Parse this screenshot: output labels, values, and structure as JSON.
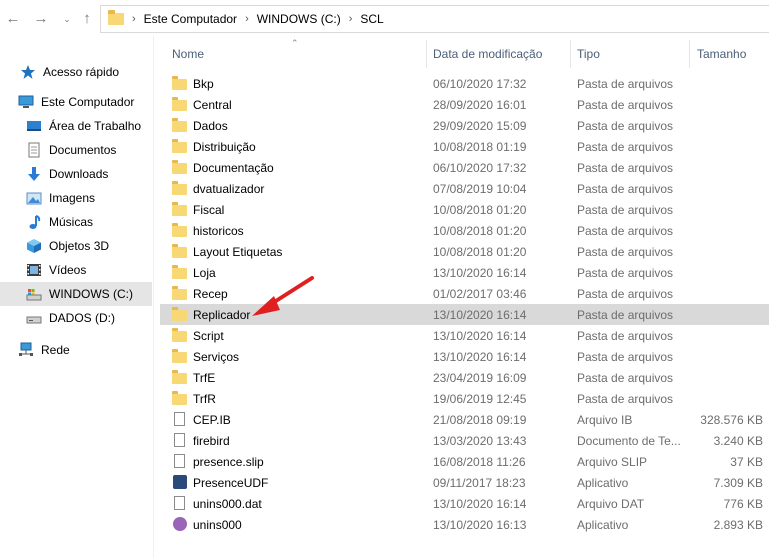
{
  "addressbar": {
    "path": [
      "Este Computador",
      "WINDOWS (C:)",
      "SCL"
    ]
  },
  "nav": {
    "items": [
      {
        "label": "Acesso rápido",
        "icon": "star-icon"
      },
      {
        "label": "Este Computador",
        "icon": "computer-icon"
      },
      {
        "label": "Área de Trabalho",
        "icon": "desktop-icon"
      },
      {
        "label": "Documentos",
        "icon": "documents-icon"
      },
      {
        "label": "Downloads",
        "icon": "download-icon"
      },
      {
        "label": "Imagens",
        "icon": "images-icon"
      },
      {
        "label": "Músicas",
        "icon": "music-icon"
      },
      {
        "label": "Objetos 3D",
        "icon": "cube-icon"
      },
      {
        "label": "Vídeos",
        "icon": "video-icon"
      },
      {
        "label": "WINDOWS (C:)",
        "icon": "drive-c-icon",
        "selected": true
      },
      {
        "label": "DADOS (D:)",
        "icon": "drive-d-icon"
      },
      {
        "label": "Rede",
        "icon": "network-icon"
      }
    ]
  },
  "columns": {
    "name": "Nome",
    "date": "Data de modificação",
    "type": "Tipo",
    "size": "Tamanho"
  },
  "files": [
    {
      "name": "Bkp",
      "date": "06/10/2020 17:32",
      "type": "Pasta de arquivos",
      "size": "",
      "icon": "folder-icon"
    },
    {
      "name": "Central",
      "date": "28/09/2020 16:01",
      "type": "Pasta de arquivos",
      "size": "",
      "icon": "folder-icon"
    },
    {
      "name": "Dados",
      "date": "29/09/2020 15:09",
      "type": "Pasta de arquivos",
      "size": "",
      "icon": "folder-icon"
    },
    {
      "name": "Distribuição",
      "date": "10/08/2018 01:19",
      "type": "Pasta de arquivos",
      "size": "",
      "icon": "folder-icon"
    },
    {
      "name": "Documentação",
      "date": "06/10/2020 17:32",
      "type": "Pasta de arquivos",
      "size": "",
      "icon": "folder-icon"
    },
    {
      "name": "dvatualizador",
      "date": "07/08/2019 10:04",
      "type": "Pasta de arquivos",
      "size": "",
      "icon": "folder-icon"
    },
    {
      "name": "Fiscal",
      "date": "10/08/2018 01:20",
      "type": "Pasta de arquivos",
      "size": "",
      "icon": "folder-icon"
    },
    {
      "name": "historicos",
      "date": "10/08/2018 01:20",
      "type": "Pasta de arquivos",
      "size": "",
      "icon": "folder-icon"
    },
    {
      "name": "Layout Etiquetas",
      "date": "10/08/2018 01:20",
      "type": "Pasta de arquivos",
      "size": "",
      "icon": "folder-icon"
    },
    {
      "name": "Loja",
      "date": "13/10/2020 16:14",
      "type": "Pasta de arquivos",
      "size": "",
      "icon": "folder-icon"
    },
    {
      "name": "Recep",
      "date": "01/02/2017 03:46",
      "type": "Pasta de arquivos",
      "size": "",
      "icon": "folder-icon"
    },
    {
      "name": "Replicador",
      "date": "13/10/2020 16:14",
      "type": "Pasta de arquivos",
      "size": "",
      "icon": "folder-icon",
      "selected": true
    },
    {
      "name": "Script",
      "date": "13/10/2020 16:14",
      "type": "Pasta de arquivos",
      "size": "",
      "icon": "folder-icon"
    },
    {
      "name": "Serviços",
      "date": "13/10/2020 16:14",
      "type": "Pasta de arquivos",
      "size": "",
      "icon": "folder-icon"
    },
    {
      "name": "TrfE",
      "date": "23/04/2019 16:09",
      "type": "Pasta de arquivos",
      "size": "",
      "icon": "folder-icon"
    },
    {
      "name": "TrfR",
      "date": "19/06/2019 12:45",
      "type": "Pasta de arquivos",
      "size": "",
      "icon": "folder-icon"
    },
    {
      "name": "CEP.IB",
      "date": "21/08/2018 09:19",
      "type": "Arquivo IB",
      "size": "328.576 KB",
      "icon": "file-icon"
    },
    {
      "name": "firebird",
      "date": "13/03/2020 13:43",
      "type": "Documento de Te...",
      "size": "3.240 KB",
      "icon": "file-icon"
    },
    {
      "name": "presence.slip",
      "date": "16/08/2018 11:26",
      "type": "Arquivo SLIP",
      "size": "37 KB",
      "icon": "file-icon"
    },
    {
      "name": "PresenceUDF",
      "date": "09/11/2017 18:23",
      "type": "Aplicativo",
      "size": "7.309 KB",
      "icon": "app-icon"
    },
    {
      "name": "unins000.dat",
      "date": "13/10/2020 16:14",
      "type": "Arquivo DAT",
      "size": "776 KB",
      "icon": "file-icon"
    },
    {
      "name": "unins000",
      "date": "13/10/2020 16:13",
      "type": "Aplicativo",
      "size": "2.893 KB",
      "icon": "uninstaller-icon"
    }
  ],
  "colors": {
    "selection": "#d9d9d9",
    "nav_selected": "#e5e5e5",
    "folder": "#f8d775",
    "arrow": "#e02020"
  }
}
